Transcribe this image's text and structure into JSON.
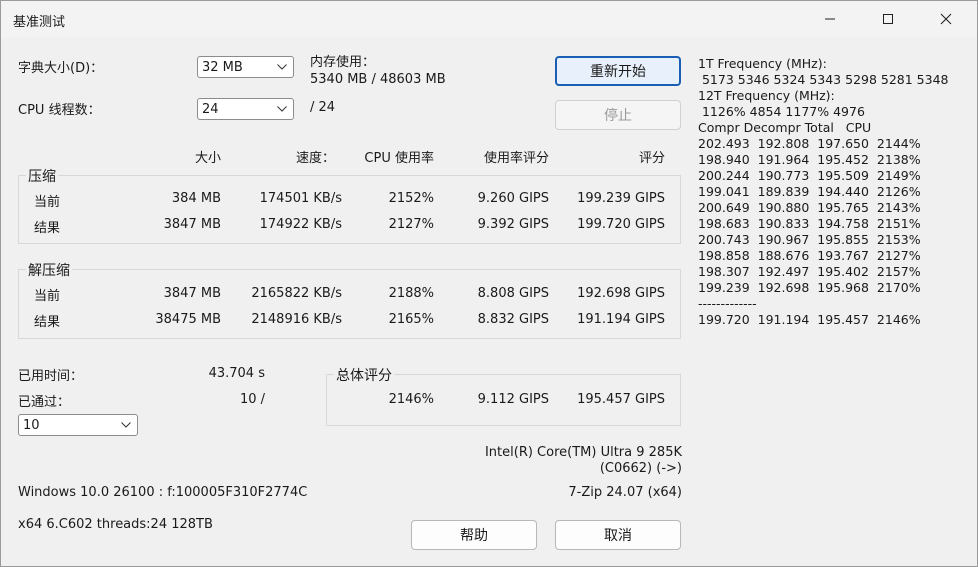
{
  "window": {
    "title": "基准测试"
  },
  "controls": {
    "dict_label": "字典大小(D)：",
    "dict_value": "32 MB",
    "threads_label": "CPU 线程数：",
    "threads_value": "24",
    "threads_total": "/ 24",
    "mem_label": "内存使用：",
    "mem_value": "5340 MB / 48603 MB",
    "restart_button": "重新开始",
    "stop_button": "停止"
  },
  "table": {
    "headers": [
      "大小",
      "速度：",
      "CPU 使用率",
      "使用率评分",
      "评分"
    ],
    "compress_label": "压缩",
    "decompress_label": "解压缩",
    "compress_rows": [
      {
        "label": "当前",
        "size": "384 MB",
        "speed": "174501 KB/s",
        "cpu": "2152%",
        "rating_usage": "9.260 GIPS",
        "rating": "199.239 GIPS"
      },
      {
        "label": "结果",
        "size": "3847 MB",
        "speed": "174922 KB/s",
        "cpu": "2127%",
        "rating_usage": "9.392 GIPS",
        "rating": "199.720 GIPS"
      }
    ],
    "decompress_rows": [
      {
        "label": "当前",
        "size": "3847 MB",
        "speed": "2165822 KB/s",
        "cpu": "2188%",
        "rating_usage": "8.808 GIPS",
        "rating": "192.698 GIPS"
      },
      {
        "label": "结果",
        "size": "38475 MB",
        "speed": "2148916 KB/s",
        "cpu": "2165%",
        "rating_usage": "8.832 GIPS",
        "rating": "191.194 GIPS"
      }
    ]
  },
  "bottom": {
    "elapsed_label": "已用时间：",
    "elapsed_value": "43.704 s",
    "passes_label": "已通过：",
    "passes_value": "10 /",
    "passes_select": "10",
    "total_label": "总体评分",
    "total_cpu": "2146%",
    "total_usage": "9.112 GIPS",
    "total_rating": "195.457 GIPS",
    "cpu_name": "Intel(R) Core(TM) Ultra 9 285K",
    "cpu_id": "(C0662) (->)",
    "os_info": "Windows 10.0 26100 : f:100005F310F2774C",
    "zip_version": "7-Zip 24.07 (x64)",
    "arch_info": "x64 6.C602 threads:24 128TB",
    "help_button": "帮助",
    "cancel_button": "取消"
  },
  "right_panel": {
    "lines": [
      "1T Frequency (MHz):",
      " 5173 5346 5324 5343 5298 5281 5348",
      "12T Frequency (MHz):",
      " 1126% 4854 1177% 4976",
      "Compr Decompr Total   CPU",
      "202.493  192.808  197.650  2144%",
      "198.940  191.964  195.452  2138%",
      "200.244  190.773  195.509  2149%",
      "199.041  189.839  194.440  2126%",
      "200.649  190.880  195.765  2143%",
      "198.683  190.833  194.758  2151%",
      "200.743  190.967  195.855  2153%",
      "198.858  188.676  193.767  2127%",
      "198.307  192.497  195.402  2157%",
      "199.239  192.698  195.968  2170%",
      "-------------",
      "199.720  191.194  195.457  2146%"
    ]
  }
}
